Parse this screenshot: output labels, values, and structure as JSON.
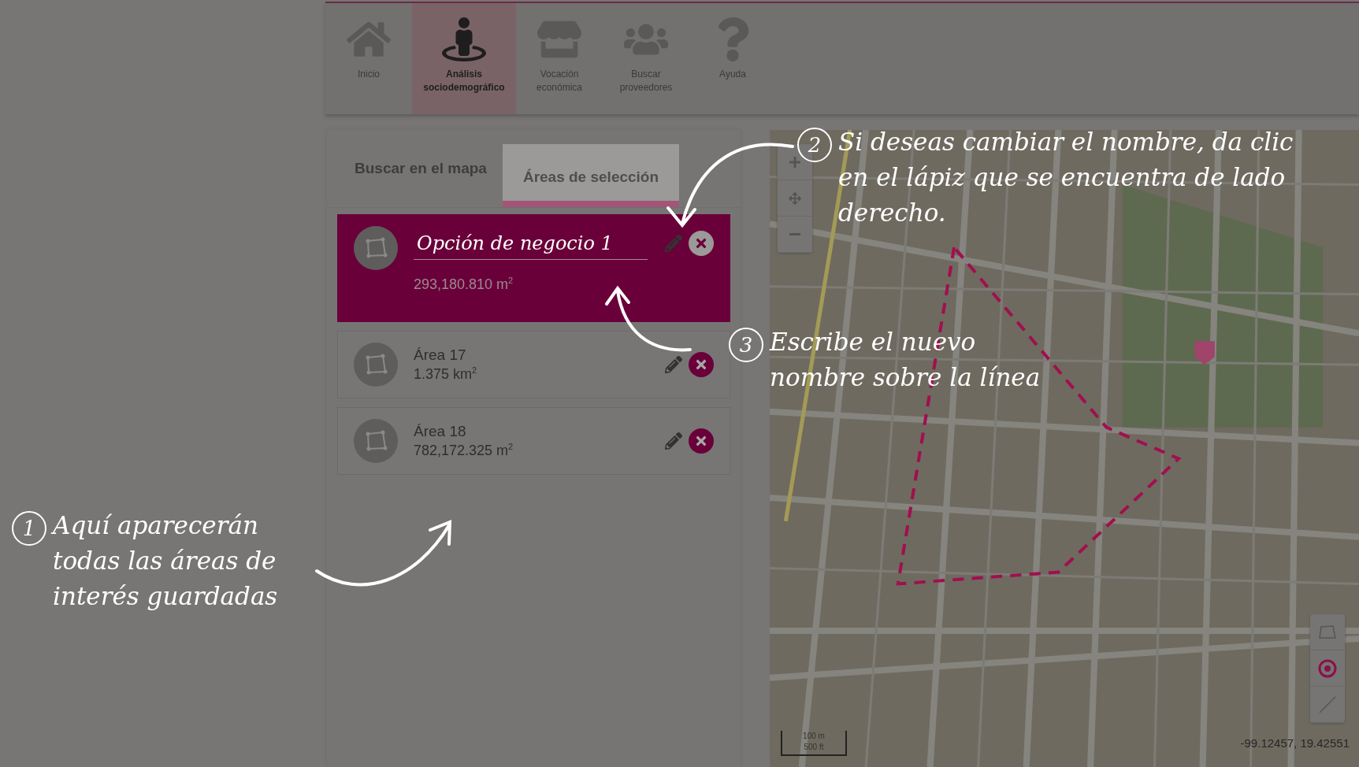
{
  "nav": [
    {
      "label": "Inicio",
      "selected": false
    },
    {
      "label": "Análisis sociodemográfico",
      "selected": true
    },
    {
      "label": "Vocación económica",
      "selected": false
    },
    {
      "label": "Buscar proveedores",
      "selected": false
    },
    {
      "label": "Ayuda",
      "selected": false
    }
  ],
  "panel": {
    "tabs": [
      {
        "label": "Buscar en el mapa",
        "selected": false
      },
      {
        "label": "Áreas de selección",
        "selected": true
      }
    ],
    "areas": [
      {
        "name": "Opción de negocio 1",
        "area": "293,180.810 m$^{2}$",
        "selected": true
      },
      {
        "name": "Área 17",
        "area": "1.375 km$^{2}$",
        "selected": false
      },
      {
        "name": "Área 18",
        "area": "782,172.325 m$^{2}$",
        "selected": false
      }
    ]
  },
  "map": {
    "scale": {
      "metric": "100 m",
      "imperial": "500 ft"
    },
    "coordinates": "-99.12457, 19.42551"
  },
  "annotations": [
    {
      "step": "2",
      "text": "Si deseas cambiar el nombre, da clic en el lápiz que se encuentra de lado derecho."
    },
    {
      "step": "3",
      "text": "Escribe el nuevo nombre sobre la línea"
    },
    {
      "step": "1",
      "text": "Aquí aparecerán todas las áreas de interés guardadas"
    }
  ]
}
